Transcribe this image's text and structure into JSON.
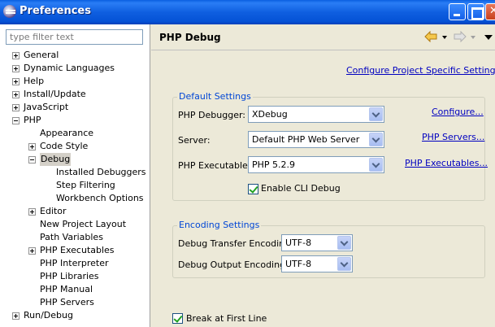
{
  "window": {
    "title": "Preferences",
    "minimize_icon": "minimize-icon",
    "maximize_icon": "maximize-icon",
    "close_icon": "close-icon"
  },
  "sidebar": {
    "filter_placeholder": "type filter text",
    "items": [
      {
        "label": "General",
        "expander": "plus",
        "level": 0
      },
      {
        "label": "Dynamic Languages",
        "expander": "plus",
        "level": 0
      },
      {
        "label": "Help",
        "expander": "plus",
        "level": 0
      },
      {
        "label": "Install/Update",
        "expander": "plus",
        "level": 0
      },
      {
        "label": "JavaScript",
        "expander": "plus",
        "level": 0
      },
      {
        "label": "PHP",
        "expander": "minus",
        "level": 0
      },
      {
        "label": "Appearance",
        "expander": "none",
        "level": 1
      },
      {
        "label": "Code Style",
        "expander": "plus",
        "level": 1
      },
      {
        "label": "Debug",
        "expander": "minus",
        "level": 1,
        "selected": true
      },
      {
        "label": "Installed Debuggers",
        "expander": "none",
        "level": 2
      },
      {
        "label": "Step Filtering",
        "expander": "none",
        "level": 2
      },
      {
        "label": "Workbench Options",
        "expander": "none",
        "level": 2
      },
      {
        "label": "Editor",
        "expander": "plus",
        "level": 1
      },
      {
        "label": "New Project Layout",
        "expander": "none",
        "level": 1
      },
      {
        "label": "Path Variables",
        "expander": "none",
        "level": 1
      },
      {
        "label": "PHP Executables",
        "expander": "plus",
        "level": 1
      },
      {
        "label": "PHP Interpreter",
        "expander": "none",
        "level": 1
      },
      {
        "label": "PHP Libraries",
        "expander": "none",
        "level": 1
      },
      {
        "label": "PHP Manual",
        "expander": "none",
        "level": 1
      },
      {
        "label": "PHP Servers",
        "expander": "none",
        "level": 1
      },
      {
        "label": "Run/Debug",
        "expander": "plus",
        "level": 0
      }
    ]
  },
  "page": {
    "title": "PHP Debug",
    "back_icon": "back-arrow-icon",
    "forward_icon": "forward-arrow-icon",
    "menu_icon": "view-menu-icon",
    "configure_project_link": "Configure Project Specific Settings...",
    "default_settings": {
      "title": "Default Settings",
      "debugger_label": "PHP Debugger:",
      "debugger_value": "XDebug",
      "configure_link": "Configure...",
      "server_label": "Server:",
      "server_value": "Default PHP Web Server",
      "servers_link": "PHP Servers...",
      "executable_label": "PHP Executable:",
      "executable_value": "PHP 5.2.9",
      "executables_link": "PHP Executables...",
      "cli_debug_label": "Enable CLI Debug",
      "cli_debug_checked": true
    },
    "encoding_settings": {
      "title": "Encoding Settings",
      "transfer_label": "Debug Transfer Encoding",
      "transfer_value": "UTF-8",
      "output_label": "Debug Output Encoding",
      "output_value": "UTF-8"
    },
    "break_first_line_label": "Break at First Line",
    "break_first_line_checked": true
  },
  "colors": {
    "titlebar": "#0a5fe0",
    "link": "#0000c0",
    "group_title": "#0046d5",
    "panel_bg": "#ece9d8"
  }
}
